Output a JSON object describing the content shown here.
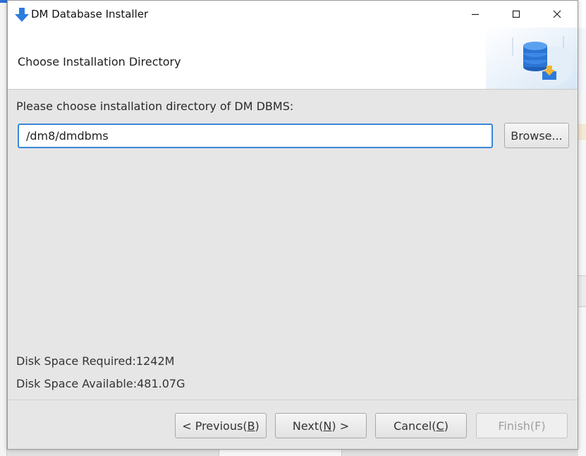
{
  "window": {
    "title": "DM Database Installer",
    "accent": "#2b7de0"
  },
  "header": {
    "title": "Choose Installation Directory",
    "art_icon": "database-install-icon"
  },
  "content": {
    "prompt": "Please choose installation directory of DM DBMS:",
    "directory_value": "/dm8/dmdbms",
    "browse_label": "Browse...",
    "disk_required": "Disk Space Required:1242M",
    "disk_available": "Disk Space Available:481.07G"
  },
  "footer": {
    "previous": {
      "before": "< Previous(",
      "key": "B",
      "after": ")"
    },
    "next": {
      "before": "Next(",
      "key": "N",
      "after": ") >"
    },
    "cancel": {
      "before": "Cancel(",
      "key": "C",
      "after": ")"
    },
    "finish": "Finish(F)"
  },
  "colors": {
    "input_focus": "#3b87d8",
    "dialog_bg": "#e6e6e6",
    "disabled_text": "#a0a0a0"
  }
}
